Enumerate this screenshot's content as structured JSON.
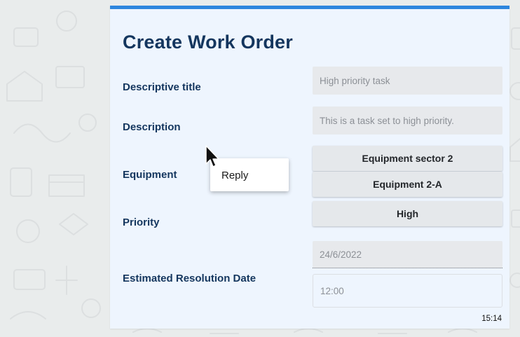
{
  "form": {
    "title": "Create Work Order",
    "fields": {
      "descriptive_title": {
        "label": "Descriptive title",
        "placeholder": "High priority task"
      },
      "description": {
        "label": "Description",
        "placeholder": "This is a task set to high priority."
      },
      "equipment": {
        "label": "Equipment",
        "options": [
          "Equipment sector 2",
          "Equipment 2-A"
        ]
      },
      "priority": {
        "label": "Priority",
        "value": "High"
      },
      "estimated_resolution": {
        "label": "Estimated Resolution Date",
        "date": "24/6/2022",
        "time": "12:00"
      }
    },
    "timestamp": "15:14"
  },
  "context_menu": {
    "items": [
      {
        "label": "Reply"
      }
    ]
  },
  "colors": {
    "accent": "#2e86de",
    "heading": "#14365e",
    "card_background": "#eef5fe",
    "wallpaper": "#e9ecec"
  },
  "icons": [
    "mouse-pointer-icon"
  ]
}
